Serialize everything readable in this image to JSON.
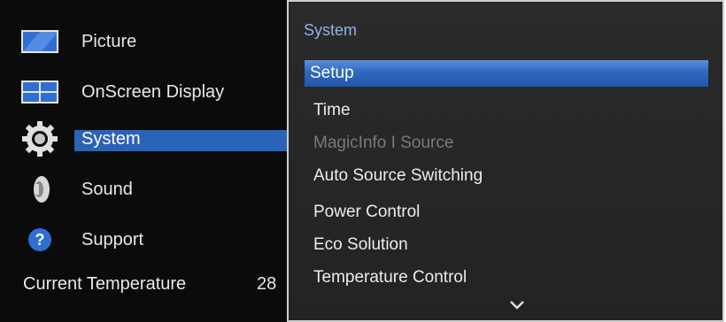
{
  "main_menu": {
    "items": [
      {
        "label": "Picture",
        "icon": "picture-icon"
      },
      {
        "label": "OnScreen Display",
        "icon": "onscreen-display-icon"
      },
      {
        "label": "System",
        "icon": "gear-icon",
        "selected": true
      },
      {
        "label": "Sound",
        "icon": "speaker-icon"
      },
      {
        "label": "Support",
        "icon": "question-icon"
      }
    ],
    "temperature": {
      "label": "Current Temperature",
      "value": "28"
    }
  },
  "submenu": {
    "title": "System",
    "items": [
      {
        "label": "Setup",
        "selected": true
      },
      {
        "label": "Time"
      },
      {
        "label": "MagicInfo I Source",
        "disabled": true
      },
      {
        "label": "Auto Source Switching"
      },
      {
        "label": "Power Control"
      },
      {
        "label": "Eco Solution"
      },
      {
        "label": "Temperature Control"
      }
    ],
    "scroll_icon": "chevron-down-icon"
  },
  "colors": {
    "selection": "#2a63b7",
    "title": "#8fb4e6",
    "panel": "#0b0b0b"
  }
}
